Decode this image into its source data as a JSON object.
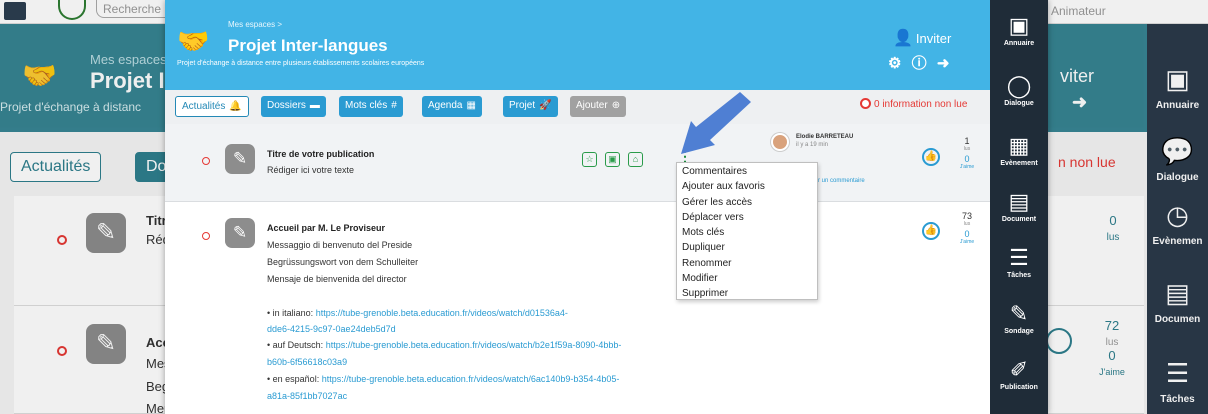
{
  "background": {
    "search_placeholder": "Recherche",
    "animateur": "Animateur",
    "breadcrumb": "Mes espaces",
    "title": "Projet I",
    "subtitle": "Projet d'échange à distanc",
    "invite": "viter",
    "nonlue": "n non lue",
    "btn_actualites": "Actualités",
    "btn_dossiers": "Dos",
    "card1": {
      "title": "Titr",
      "text": "Réd",
      "lus_n": "0",
      "lus_u": "lus"
    },
    "card2": {
      "title": "Acc",
      "l1": "Mes",
      "l2": "Beg",
      "l3": "Mer",
      "lus_n": "72",
      "lus_u": "lus",
      "aime_n": "0",
      "aime_u": "J'aime"
    },
    "rail": [
      "Annuaire",
      "Dialogue",
      "Evènemen",
      "Documen",
      "Tâches"
    ]
  },
  "modal": {
    "breadcrumb": "Mes espaces >",
    "title": "Projet Inter-langues",
    "subtitle": "Projet d'échange à distance entre plusieurs établissements scolaires européens",
    "invite": "Inviter",
    "toolbar": {
      "actualites": "Actualités",
      "dossiers": "Dossiers",
      "mots_cles": "Mots clés",
      "agenda": "Agenda",
      "projet": "Projet",
      "ajouter": "Ajouter"
    },
    "info_nonlue": "0 information non lue",
    "rail": [
      "Annuaire",
      "Dialogue",
      "Evènement",
      "Document",
      "Tâches",
      "Sondage",
      "Publication"
    ],
    "post1": {
      "title": "Titre de votre publication",
      "text": "Rédiger ici votre texte",
      "author": "Elodie BARRETEAU",
      "ago": "il y a 19 min",
      "comment_link": "ter un commentaire",
      "lus_n": "1",
      "lus_u": "lus",
      "aime_n": "0",
      "aime_u": "J'aime"
    },
    "post2": {
      "title": "Accueil par M. Le Proviseur",
      "lines": [
        "Messaggio di benvenuto del Preside",
        "Begrüssungswort von dem Schulleiter",
        "Mensaje de bienvenida del director"
      ],
      "links": [
        {
          "prefix": "• in italiano: ",
          "url1": "https://tube-grenoble.beta.education.fr/videos/watch/d01536a4-",
          "url2": "dde6-4215-9c97-0ae24deb5d7d"
        },
        {
          "prefix": "• auf Deutsch: ",
          "url1": "https://tube-grenoble.beta.education.fr/videos/watch/b2e1f59a-8090-4bbb-",
          "url2": "b60b-6f56618c03a9"
        },
        {
          "prefix": "• en español: ",
          "url1": "https://tube-grenoble.beta.education.fr/videos/watch/6ac140b9-b354-4b05-",
          "url2": "a81a-85f1bb7027ac"
        }
      ],
      "lus_n": "73",
      "lus_u": "lus",
      "aime_n": "0",
      "aime_u": "J'aime"
    },
    "context_menu": [
      "Commentaires",
      "Ajouter aux favoris",
      "Gérer les accès",
      "Déplacer vers",
      "Mots clés",
      "Dupliquer",
      "Renommer",
      "Modifier",
      "Supprimer"
    ]
  },
  "colors": {
    "accent": "#42b4e6",
    "pointer_arrow": "#4f7fd3",
    "alert": "#e53935",
    "rail": "#1f2c38"
  }
}
